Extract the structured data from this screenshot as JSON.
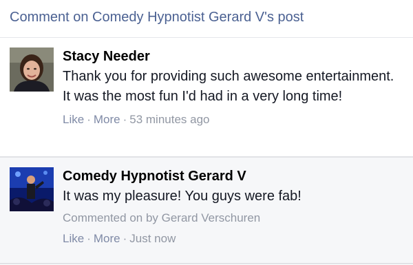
{
  "header": {
    "title": "Comment on Comedy Hypnotist Gerard V's post"
  },
  "comments": [
    {
      "name": "Stacy Needer",
      "text": "Thank you for providing such awesome entertainment. It was the most fun I'd had in a very long time!",
      "like": "Like",
      "more": "More",
      "time": "53 minutes ago",
      "sep": "·"
    },
    {
      "name": "Comedy Hypnotist Gerard V",
      "text": "It was my pleasure! You guys were fab!",
      "attribution": "Commented on by Gerard Verschuren",
      "like": "Like",
      "more": "More",
      "time": "Just now",
      "sep": "·"
    }
  ],
  "colors": {
    "header_text": "#4b6192",
    "meta_text": "#9197a3",
    "reply_bg": "#f6f7f9"
  }
}
